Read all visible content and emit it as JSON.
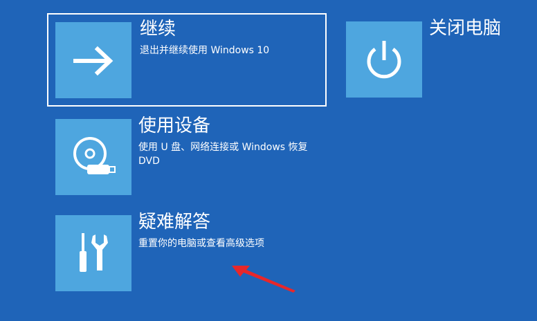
{
  "options": {
    "continue": {
      "title": "继续",
      "description": "退出并继续使用 Windows 10",
      "icon": "arrow-right-icon"
    },
    "shutdown": {
      "title": "关闭电脑",
      "icon": "power-icon"
    },
    "device": {
      "title": "使用设备",
      "description": "使用 U 盘、网络连接或 Windows 恢复 DVD",
      "icon": "disc-usb-icon"
    },
    "troubleshoot": {
      "title": "疑难解答",
      "description": "重置你的电脑或查看高级选项",
      "icon": "tools-icon"
    }
  },
  "colors": {
    "background": "#1f64b8",
    "tile": "#4ea6df",
    "text": "#ffffff",
    "annotation": "#e8272a"
  }
}
